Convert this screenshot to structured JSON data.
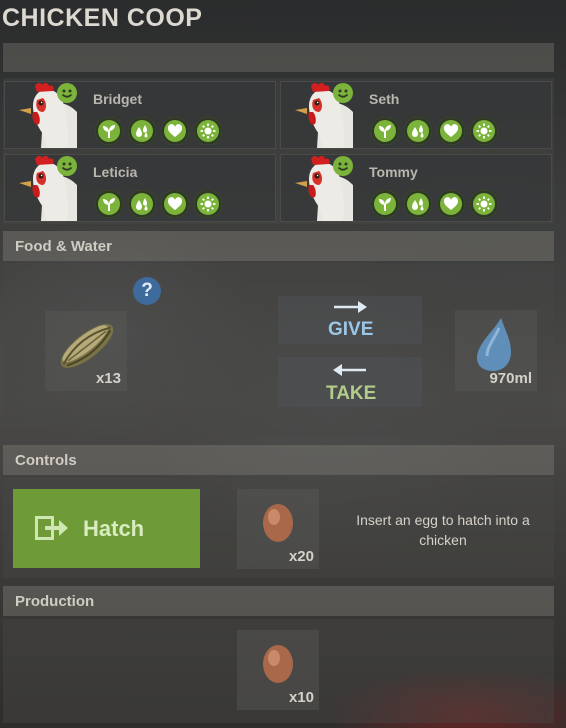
{
  "window": {
    "title": "CHICKEN COOP"
  },
  "chickens": [
    {
      "name": "Bridget",
      "mood_icon": "smile-icon",
      "stats": [
        "plant-icon",
        "water-drops-icon",
        "heart-icon",
        "sun-icon"
      ]
    },
    {
      "name": "Seth",
      "mood_icon": "smile-icon",
      "stats": [
        "plant-icon",
        "water-drops-icon",
        "heart-icon",
        "sun-icon"
      ]
    },
    {
      "name": "Leticia",
      "mood_icon": "smile-icon",
      "stats": [
        "plant-icon",
        "water-drops-icon",
        "heart-icon",
        "sun-icon"
      ]
    },
    {
      "name": "Tommy",
      "mood_icon": "smile-icon",
      "stats": [
        "plant-icon",
        "water-drops-icon",
        "heart-icon",
        "sun-icon"
      ]
    }
  ],
  "food_water": {
    "header": "Food & Water",
    "help": "?",
    "food": {
      "icon": "corn-seed-icon",
      "qty": "x13"
    },
    "water": {
      "icon": "water-drop-icon",
      "qty": "970ml"
    },
    "give_label": "GIVE",
    "take_label": "TAKE"
  },
  "controls": {
    "header": "Controls",
    "hatch_label": "Hatch",
    "egg": {
      "icon": "egg-icon",
      "qty": "x20"
    },
    "description": "Insert an egg to hatch into a chicken"
  },
  "production": {
    "header": "Production",
    "egg": {
      "icon": "egg-icon",
      "qty": "x10"
    }
  },
  "colors": {
    "accent_green": "#7bb33b",
    "hatch_button": "#6e9a37",
    "give_blue": "#9cc6e6",
    "take_green": "#b2cc8a"
  }
}
